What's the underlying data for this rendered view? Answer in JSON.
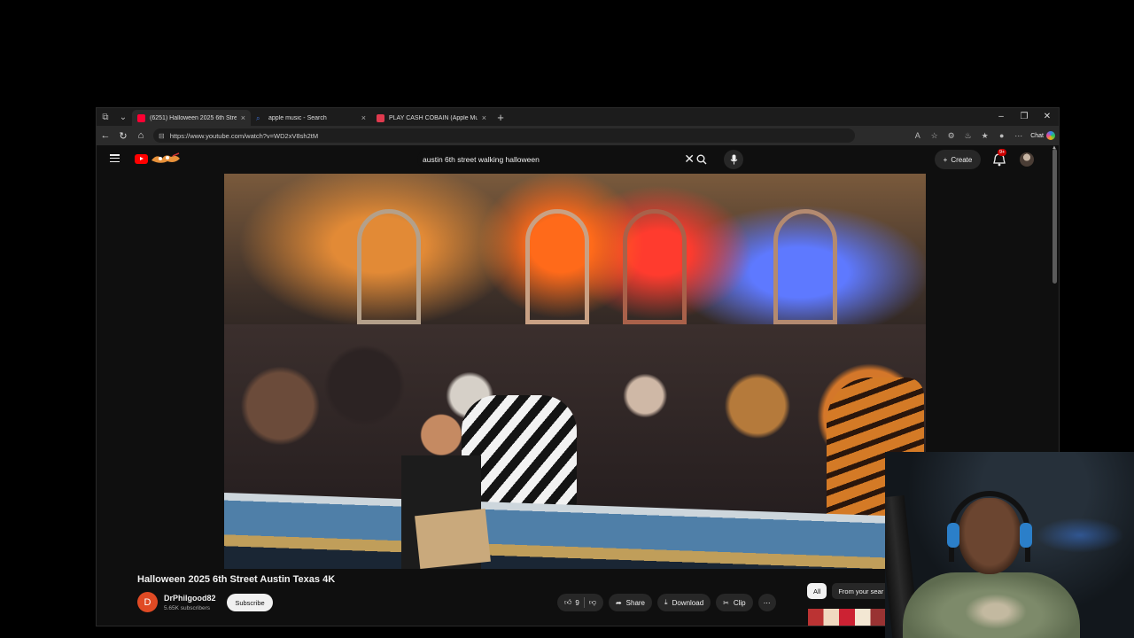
{
  "browser": {
    "tabs": [
      {
        "title": "(6251) Halloween 2025 6th Street",
        "favicon_color": "#ff0033",
        "active": true
      },
      {
        "title": "apple music - Search",
        "favicon_color": "#3b6fd8",
        "active": false
      },
      {
        "title": "PLAY CASH COBAIN (Apple Music",
        "favicon_color": "#e03a4e",
        "active": false
      }
    ],
    "url": "https://www.youtube.com/watch?v=WD2xV8sh2tM",
    "chat_label": "Chat"
  },
  "youtube": {
    "search_query": "austin 6th street walking halloween",
    "create_label": "Create",
    "notification_badge": "9+",
    "video": {
      "title": "Halloween 2025 6th Street Austin Texas 4K",
      "channel": "DrPhilgood82",
      "channel_initial": "D",
      "subscribers": "5.65K subscribers",
      "subscribe_label": "Subscribe",
      "likes": "9",
      "share_label": "Share",
      "download_label": "Download",
      "clip_label": "Clip"
    },
    "chips": [
      {
        "label": "All",
        "active": true
      },
      {
        "label": "From your sear",
        "active": false
      }
    ]
  },
  "colors": {
    "youtube_red": "#ff0000",
    "background": "#0f0f0f",
    "pill": "#272727"
  }
}
